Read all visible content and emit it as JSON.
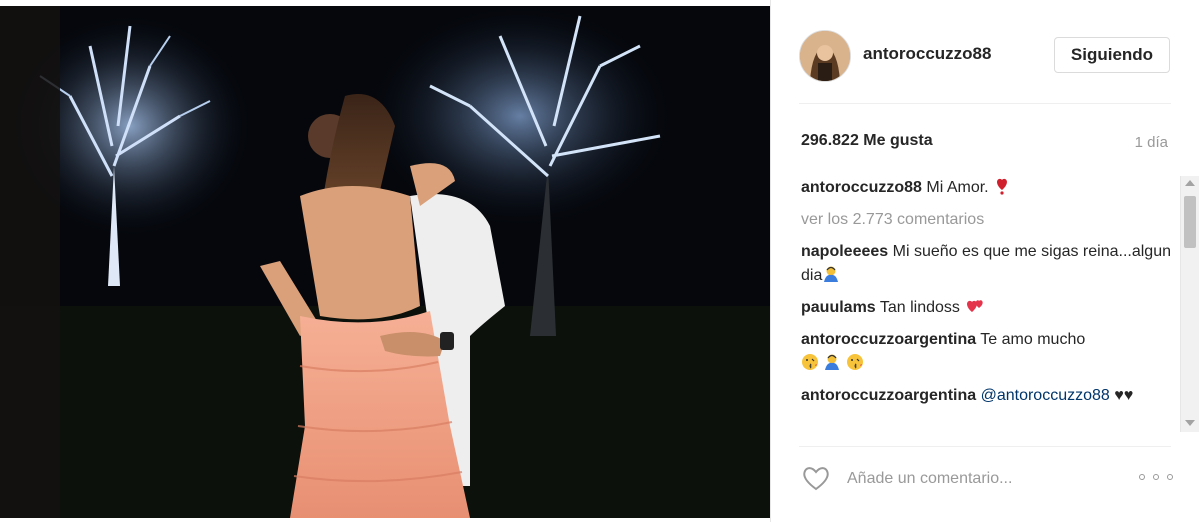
{
  "post": {
    "username": "antoroccuzzo88",
    "follow_label": "Siguiendo",
    "likes": "296.822 Me gusta",
    "timestamp": "1 día"
  },
  "caption": {
    "user": "antoroccuzzo88",
    "text": "Mi Amor.",
    "emoji": "heart-exclamation-emoji"
  },
  "view_comments_label": "ver los 2.773 comentarios",
  "comments": [
    {
      "user": "napoleeees",
      "text": "Mi sueño es que me sigas reina...algun dia",
      "emoji": "person-bowing-emoji"
    },
    {
      "user": "pauulams",
      "text": "Tan lindoss",
      "emoji": "two-hearts-emoji"
    },
    {
      "user": "antoroccuzzoargentina",
      "text": "Te amo mucho",
      "emoji": "kiss-bow-kiss-emojis"
    },
    {
      "user": "antoroccuzzoargentina",
      "text": "@antoroccuzzo88",
      "tail": "♥♥"
    }
  ],
  "composer": {
    "placeholder": "Añade un comentario..."
  },
  "colors": {
    "username": "#262626",
    "muted": "#999999",
    "mention": "#003569",
    "dress": "#f0a489"
  }
}
